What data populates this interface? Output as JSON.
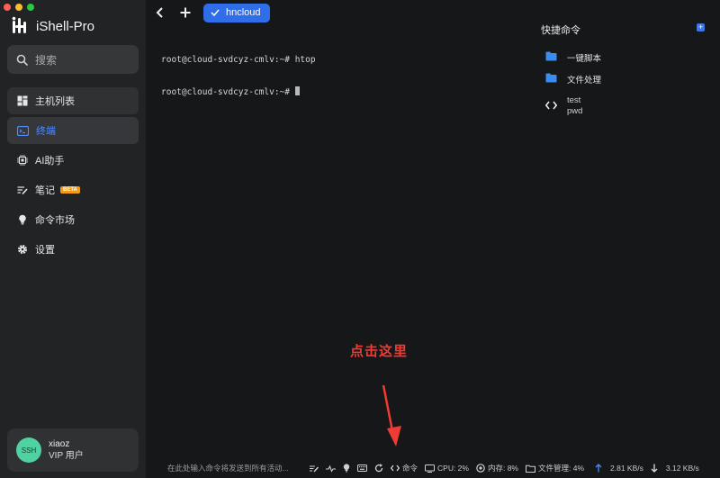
{
  "app": {
    "title": "iShell-Pro"
  },
  "colors": {
    "accent": "#2f6ee8",
    "active_text": "#4f8cff",
    "annotation": "#ee3b34",
    "beta_badge": "#f29b18",
    "avatar": "#4fd1a2"
  },
  "sidebar": {
    "search_placeholder": "搜索",
    "items": [
      {
        "label": "主机列表",
        "icon": "grid-icon"
      },
      {
        "label": "终端",
        "icon": "terminal-icon",
        "active": true
      },
      {
        "label": "AI助手",
        "icon": "chip-icon"
      },
      {
        "label": "笔记",
        "icon": "note-icon",
        "badge": "BETA"
      },
      {
        "label": "命令市场",
        "icon": "bulb-icon"
      },
      {
        "label": "设置",
        "icon": "gear-icon"
      }
    ],
    "user": {
      "avatar_text": "SSH",
      "name": "xiaoz",
      "level": "VIP 用户"
    }
  },
  "tabs": {
    "active_label": "hncloud"
  },
  "terminal": {
    "lines": [
      "root@cloud-svdcyz-cmlv:~# htop",
      "root@cloud-svdcyz-cmlv:~# "
    ]
  },
  "quick_commands": {
    "title": "快捷命令",
    "items": [
      {
        "type": "folder",
        "label": "一键脚本"
      },
      {
        "type": "folder",
        "label": "文件处理"
      },
      {
        "type": "command",
        "label": "test",
        "sub": "pwd"
      }
    ]
  },
  "annotation": {
    "text": "点击这里"
  },
  "status": {
    "input_placeholder": "在此处输入命令将发送到所有活动...",
    "command_label": "命令",
    "cpu": "CPU: 2%",
    "memory": "内存: 8%",
    "files": "文件管理: 4%",
    "upload": "2.81 KB/s",
    "download": "3.12 KB/s"
  }
}
